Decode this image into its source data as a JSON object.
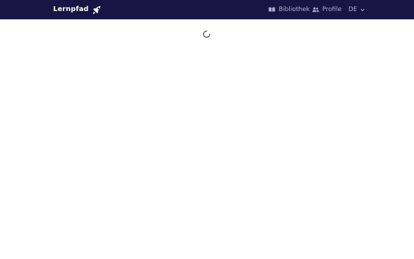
{
  "header": {
    "brand": "Lernpfad",
    "brand_icon": "rocket-icon",
    "nav": {
      "library_label": "Bibliothek",
      "library_icon": "book-open-icon",
      "profiles_label": "Profile",
      "profiles_icon": "users-icon",
      "language_label": "DE",
      "language_icon": "chevron-down-icon"
    },
    "colors": {
      "background": "#181443",
      "brand_text": "#ffffff",
      "nav_text": "#b3b2d6"
    }
  },
  "main": {
    "loading_indicator": "spinner",
    "spinner_color": "#4a4a4a"
  }
}
